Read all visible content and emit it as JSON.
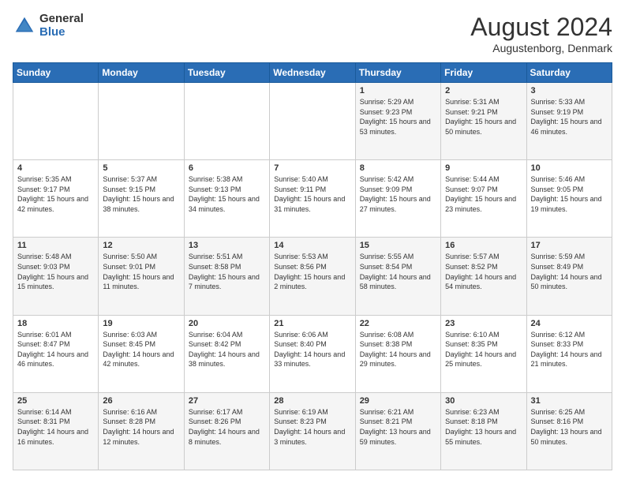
{
  "header": {
    "logo_general": "General",
    "logo_blue": "Blue",
    "title": "August 2024",
    "subtitle": "Augustenborg, Denmark"
  },
  "days_of_week": [
    "Sunday",
    "Monday",
    "Tuesday",
    "Wednesday",
    "Thursday",
    "Friday",
    "Saturday"
  ],
  "weeks": [
    {
      "days": [
        {
          "num": "",
          "info": ""
        },
        {
          "num": "",
          "info": ""
        },
        {
          "num": "",
          "info": ""
        },
        {
          "num": "",
          "info": ""
        },
        {
          "num": "1",
          "sunrise": "Sunrise: 5:29 AM",
          "sunset": "Sunset: 9:23 PM",
          "daylight": "Daylight: 15 hours and 53 minutes."
        },
        {
          "num": "2",
          "sunrise": "Sunrise: 5:31 AM",
          "sunset": "Sunset: 9:21 PM",
          "daylight": "Daylight: 15 hours and 50 minutes."
        },
        {
          "num": "3",
          "sunrise": "Sunrise: 5:33 AM",
          "sunset": "Sunset: 9:19 PM",
          "daylight": "Daylight: 15 hours and 46 minutes."
        }
      ]
    },
    {
      "days": [
        {
          "num": "4",
          "sunrise": "Sunrise: 5:35 AM",
          "sunset": "Sunset: 9:17 PM",
          "daylight": "Daylight: 15 hours and 42 minutes."
        },
        {
          "num": "5",
          "sunrise": "Sunrise: 5:37 AM",
          "sunset": "Sunset: 9:15 PM",
          "daylight": "Daylight: 15 hours and 38 minutes."
        },
        {
          "num": "6",
          "sunrise": "Sunrise: 5:38 AM",
          "sunset": "Sunset: 9:13 PM",
          "daylight": "Daylight: 15 hours and 34 minutes."
        },
        {
          "num": "7",
          "sunrise": "Sunrise: 5:40 AM",
          "sunset": "Sunset: 9:11 PM",
          "daylight": "Daylight: 15 hours and 31 minutes."
        },
        {
          "num": "8",
          "sunrise": "Sunrise: 5:42 AM",
          "sunset": "Sunset: 9:09 PM",
          "daylight": "Daylight: 15 hours and 27 minutes."
        },
        {
          "num": "9",
          "sunrise": "Sunrise: 5:44 AM",
          "sunset": "Sunset: 9:07 PM",
          "daylight": "Daylight: 15 hours and 23 minutes."
        },
        {
          "num": "10",
          "sunrise": "Sunrise: 5:46 AM",
          "sunset": "Sunset: 9:05 PM",
          "daylight": "Daylight: 15 hours and 19 minutes."
        }
      ]
    },
    {
      "days": [
        {
          "num": "11",
          "sunrise": "Sunrise: 5:48 AM",
          "sunset": "Sunset: 9:03 PM",
          "daylight": "Daylight: 15 hours and 15 minutes."
        },
        {
          "num": "12",
          "sunrise": "Sunrise: 5:50 AM",
          "sunset": "Sunset: 9:01 PM",
          "daylight": "Daylight: 15 hours and 11 minutes."
        },
        {
          "num": "13",
          "sunrise": "Sunrise: 5:51 AM",
          "sunset": "Sunset: 8:58 PM",
          "daylight": "Daylight: 15 hours and 7 minutes."
        },
        {
          "num": "14",
          "sunrise": "Sunrise: 5:53 AM",
          "sunset": "Sunset: 8:56 PM",
          "daylight": "Daylight: 15 hours and 2 minutes."
        },
        {
          "num": "15",
          "sunrise": "Sunrise: 5:55 AM",
          "sunset": "Sunset: 8:54 PM",
          "daylight": "Daylight: 14 hours and 58 minutes."
        },
        {
          "num": "16",
          "sunrise": "Sunrise: 5:57 AM",
          "sunset": "Sunset: 8:52 PM",
          "daylight": "Daylight: 14 hours and 54 minutes."
        },
        {
          "num": "17",
          "sunrise": "Sunrise: 5:59 AM",
          "sunset": "Sunset: 8:49 PM",
          "daylight": "Daylight: 14 hours and 50 minutes."
        }
      ]
    },
    {
      "days": [
        {
          "num": "18",
          "sunrise": "Sunrise: 6:01 AM",
          "sunset": "Sunset: 8:47 PM",
          "daylight": "Daylight: 14 hours and 46 minutes."
        },
        {
          "num": "19",
          "sunrise": "Sunrise: 6:03 AM",
          "sunset": "Sunset: 8:45 PM",
          "daylight": "Daylight: 14 hours and 42 minutes."
        },
        {
          "num": "20",
          "sunrise": "Sunrise: 6:04 AM",
          "sunset": "Sunset: 8:42 PM",
          "daylight": "Daylight: 14 hours and 38 minutes."
        },
        {
          "num": "21",
          "sunrise": "Sunrise: 6:06 AM",
          "sunset": "Sunset: 8:40 PM",
          "daylight": "Daylight: 14 hours and 33 minutes."
        },
        {
          "num": "22",
          "sunrise": "Sunrise: 6:08 AM",
          "sunset": "Sunset: 8:38 PM",
          "daylight": "Daylight: 14 hours and 29 minutes."
        },
        {
          "num": "23",
          "sunrise": "Sunrise: 6:10 AM",
          "sunset": "Sunset: 8:35 PM",
          "daylight": "Daylight: 14 hours and 25 minutes."
        },
        {
          "num": "24",
          "sunrise": "Sunrise: 6:12 AM",
          "sunset": "Sunset: 8:33 PM",
          "daylight": "Daylight: 14 hours and 21 minutes."
        }
      ]
    },
    {
      "days": [
        {
          "num": "25",
          "sunrise": "Sunrise: 6:14 AM",
          "sunset": "Sunset: 8:31 PM",
          "daylight": "Daylight: 14 hours and 16 minutes."
        },
        {
          "num": "26",
          "sunrise": "Sunrise: 6:16 AM",
          "sunset": "Sunset: 8:28 PM",
          "daylight": "Daylight: 14 hours and 12 minutes."
        },
        {
          "num": "27",
          "sunrise": "Sunrise: 6:17 AM",
          "sunset": "Sunset: 8:26 PM",
          "daylight": "Daylight: 14 hours and 8 minutes."
        },
        {
          "num": "28",
          "sunrise": "Sunrise: 6:19 AM",
          "sunset": "Sunset: 8:23 PM",
          "daylight": "Daylight: 14 hours and 3 minutes."
        },
        {
          "num": "29",
          "sunrise": "Sunrise: 6:21 AM",
          "sunset": "Sunset: 8:21 PM",
          "daylight": "Daylight: 13 hours and 59 minutes."
        },
        {
          "num": "30",
          "sunrise": "Sunrise: 6:23 AM",
          "sunset": "Sunset: 8:18 PM",
          "daylight": "Daylight: 13 hours and 55 minutes."
        },
        {
          "num": "31",
          "sunrise": "Sunrise: 6:25 AM",
          "sunset": "Sunset: 8:16 PM",
          "daylight": "Daylight: 13 hours and 50 minutes."
        }
      ]
    }
  ]
}
